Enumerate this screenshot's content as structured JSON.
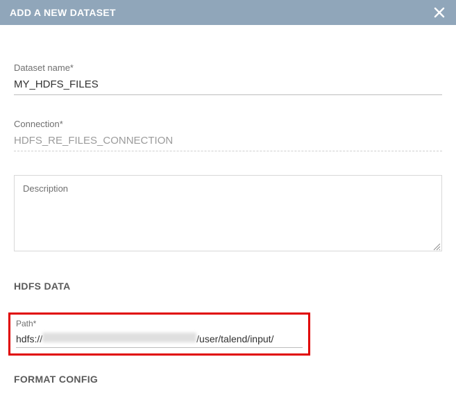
{
  "header": {
    "title": "ADD A NEW DATASET"
  },
  "fields": {
    "dataset_name": {
      "label": "Dataset name*",
      "value": "MY_HDFS_FILES"
    },
    "connection": {
      "label": "Connection*",
      "value": "HDFS_RE_FILES_CONNECTION"
    },
    "description": {
      "label": "Description",
      "value": ""
    }
  },
  "sections": {
    "hdfs_data": "HDFS DATA",
    "format_config": "FORMAT CONFIG"
  },
  "path": {
    "label": "Path*",
    "prefix": "hdfs://",
    "suffix": "/user/talend/input/"
  }
}
